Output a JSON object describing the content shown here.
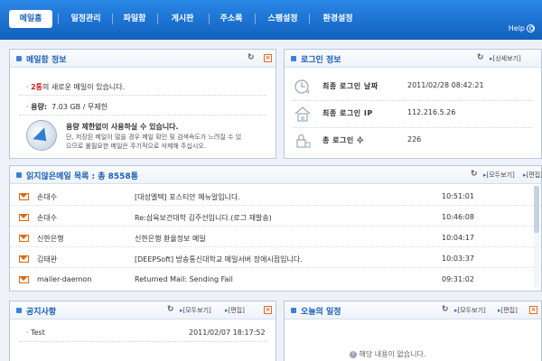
{
  "nav": {
    "tabs": [
      {
        "label": "메일홈"
      },
      {
        "label": "일정관리"
      },
      {
        "label": "파일함"
      },
      {
        "label": "게시판"
      },
      {
        "label": "주소록"
      },
      {
        "label": "스팸설정"
      },
      {
        "label": "환경설정"
      }
    ],
    "help": "Help"
  },
  "mail_info": {
    "title": "메일함 정보",
    "new_count": "2통",
    "new_suffix": "의 새로운 메일이 있습니다.",
    "capacity_label": "용량:",
    "capacity_value": "7.03 GB / 무제한",
    "notice_title": "용량 제한없이 사용하실 수 있습니다.",
    "notice_line1": "단, 저장된 메일이 많을 경우 메일 확인 및 검색속도가 느려질 수 있",
    "notice_line2": "으므로 불필요한 메일은 주기적으로 삭제해 주십시오."
  },
  "login_info": {
    "title": "로그인 정보",
    "detail_link": "[상세보기]",
    "rows": [
      {
        "label": "최종 로그인 날짜",
        "value": "2011/02/28 08:42:21"
      },
      {
        "label": "최종 로그인 IP",
        "value": "112.216.5.26"
      },
      {
        "label": "총 로그인 수",
        "value": "226"
      }
    ]
  },
  "unread": {
    "title": "읽지않은메일 목록 : 총 8558통",
    "view_all": "[모두보기]",
    "edit": "[편집]",
    "rows": [
      {
        "sender": "손대수",
        "subject": "[대성엘텍] 포스티안 메뉴얼입니다.",
        "time": "10:51:01"
      },
      {
        "sender": "손대수",
        "subject": "Re:삼육보건대학 김주선입니다.(로그 재발송)",
        "time": "10:46:08"
      },
      {
        "sender": "신한은행",
        "subject": "신한은행 환율정보 메일",
        "time": "10:04:17"
      },
      {
        "sender": "김태완",
        "subject": "[DEEPSoft] 방송통신대학교 메일서버 장애시점입니다.",
        "time": "10:03:37"
      },
      {
        "sender": "mailer-daemon",
        "subject": "Returned Mail: Sending Fail",
        "time": "09:31:02"
      }
    ]
  },
  "notice": {
    "title": "공지사항",
    "view_all": "[모두보기]",
    "edit": "[편집]",
    "items": [
      {
        "title": "Test",
        "date": "2011/02/07 18:17:52"
      }
    ]
  },
  "today": {
    "title": "오늘의 일정",
    "view_all": "[모두보기]",
    "edit": "[편집]",
    "empty": "해당 내용이 없습니다."
  }
}
